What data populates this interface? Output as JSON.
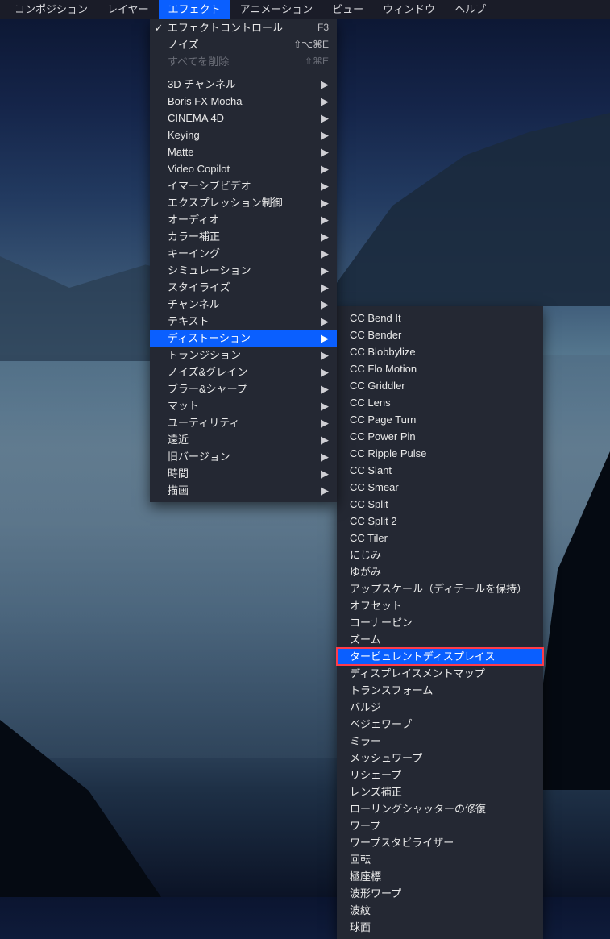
{
  "menubar": {
    "items": [
      {
        "label": "コンポジション"
      },
      {
        "label": "レイヤー"
      },
      {
        "label": "エフェクト",
        "active": true
      },
      {
        "label": "アニメーション"
      },
      {
        "label": "ビュー"
      },
      {
        "label": "ウィンドウ"
      },
      {
        "label": "ヘルプ"
      }
    ]
  },
  "dropdown": {
    "top": [
      {
        "label": "エフェクトコントロール",
        "shortcut": "F3",
        "checked": true
      },
      {
        "label": "ノイズ",
        "shortcut": "⇧⌥⌘E"
      },
      {
        "label": "すべてを削除",
        "shortcut": "⇧⌘E",
        "disabled": true
      }
    ],
    "items": [
      {
        "label": "3D チャンネル"
      },
      {
        "label": "Boris FX Mocha"
      },
      {
        "label": "CINEMA 4D"
      },
      {
        "label": "Keying"
      },
      {
        "label": "Matte"
      },
      {
        "label": "Video Copilot"
      },
      {
        "label": "イマーシブビデオ"
      },
      {
        "label": "エクスプレッション制御"
      },
      {
        "label": "オーディオ"
      },
      {
        "label": "カラー補正"
      },
      {
        "label": "キーイング"
      },
      {
        "label": "シミュレーション"
      },
      {
        "label": "スタイライズ"
      },
      {
        "label": "チャンネル"
      },
      {
        "label": "テキスト"
      },
      {
        "label": "ディストーション",
        "highlight": true
      },
      {
        "label": "トランジション"
      },
      {
        "label": "ノイズ&グレイン"
      },
      {
        "label": "ブラー&シャープ"
      },
      {
        "label": "マット"
      },
      {
        "label": "ユーティリティ"
      },
      {
        "label": "遠近"
      },
      {
        "label": "旧バージョン"
      },
      {
        "label": "時間"
      },
      {
        "label": "描画"
      }
    ]
  },
  "submenu": {
    "items": [
      {
        "label": "CC Bend It"
      },
      {
        "label": "CC Bender"
      },
      {
        "label": "CC Blobbylize"
      },
      {
        "label": "CC Flo Motion"
      },
      {
        "label": "CC Griddler"
      },
      {
        "label": "CC Lens"
      },
      {
        "label": "CC Page Turn"
      },
      {
        "label": "CC Power Pin"
      },
      {
        "label": "CC Ripple Pulse"
      },
      {
        "label": "CC Slant"
      },
      {
        "label": "CC Smear"
      },
      {
        "label": "CC Split"
      },
      {
        "label": "CC Split 2"
      },
      {
        "label": "CC Tiler"
      },
      {
        "label": "にじみ"
      },
      {
        "label": "ゆがみ"
      },
      {
        "label": "アップスケール（ディテールを保持）"
      },
      {
        "label": "オフセット"
      },
      {
        "label": "コーナーピン"
      },
      {
        "label": "ズーム"
      },
      {
        "label": "タービュレントディスプレイス",
        "outlined": true
      },
      {
        "label": "ディスプレイスメントマップ"
      },
      {
        "label": "トランスフォーム"
      },
      {
        "label": "バルジ"
      },
      {
        "label": "ベジェワープ"
      },
      {
        "label": "ミラー"
      },
      {
        "label": "メッシュワープ"
      },
      {
        "label": "リシェープ"
      },
      {
        "label": "レンズ補正"
      },
      {
        "label": "ローリングシャッターの修復"
      },
      {
        "label": "ワープ"
      },
      {
        "label": "ワープスタビライザー"
      },
      {
        "label": "回転"
      },
      {
        "label": "極座標"
      },
      {
        "label": "波形ワープ"
      },
      {
        "label": "波紋"
      },
      {
        "label": "球面"
      }
    ]
  }
}
